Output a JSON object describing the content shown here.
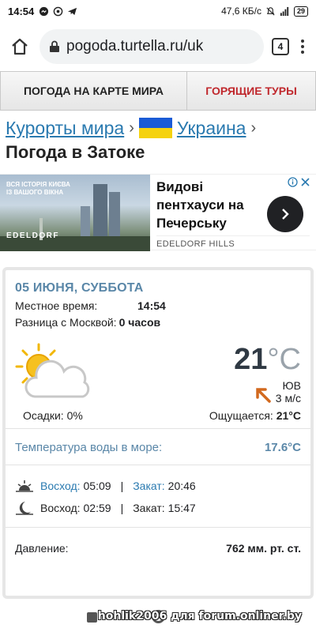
{
  "status_bar": {
    "time": "14:54",
    "network_speed": "47,6 КБ/с",
    "battery": "29"
  },
  "browser": {
    "url": "pogoda.turtella.ru/uk",
    "tab_count": "4"
  },
  "top_nav": {
    "world_map": "ПОГОДА НА КАРТЕ МИРА",
    "hot_tours": "ГОРЯЩИЕ ТУРЫ",
    "hot_tours_color": "#c0282d"
  },
  "breadcrumb": {
    "resorts": "Курорты мира",
    "country": "Украина",
    "separator": "›"
  },
  "page_title": "Погода в Затоке",
  "ad": {
    "image_text_1": "ВСЯ ІСТОРІЯ КИЄВА\nІЗ ВАШОГО ВІКНА",
    "image_text_2": "EDELDORF",
    "headline": "Видові пентхауси на Печерську",
    "brand": "EDELDORF HILLS"
  },
  "weather": {
    "date": "05 ИЮНЯ, СУББОТА",
    "local_time_label": "Местное время:",
    "local_time": "14:54",
    "moscow_diff_label": "Разница с Москвой:",
    "moscow_diff": "0 часов",
    "icon": "partly-cloudy-icon",
    "temperature": "21",
    "temperature_unit": "°C",
    "wind_direction": "ЮВ",
    "wind_speed": "3 м/с",
    "precip_label": "Осадки:",
    "precip": "0%",
    "feels_label": "Ощущается:",
    "feels": "21°C",
    "water_label": "Температура воды в море:",
    "water": "17.6°C",
    "sunrise_label": "Восход:",
    "sunrise": "05:09",
    "sunset_label": "Закат:",
    "sunset": "20:46",
    "moonrise_label": "Восход:",
    "moonrise": "02:59",
    "moonset_label": "Закат:",
    "moonset": "15:47",
    "divider": "|",
    "pressure_label": "Давление:",
    "pressure": "762 мм. рт. ст.",
    "accent_color": "#5a87a8",
    "link_color": "#2a7ab0"
  },
  "watermark": "hohlik2006 для forum.onliner.by"
}
